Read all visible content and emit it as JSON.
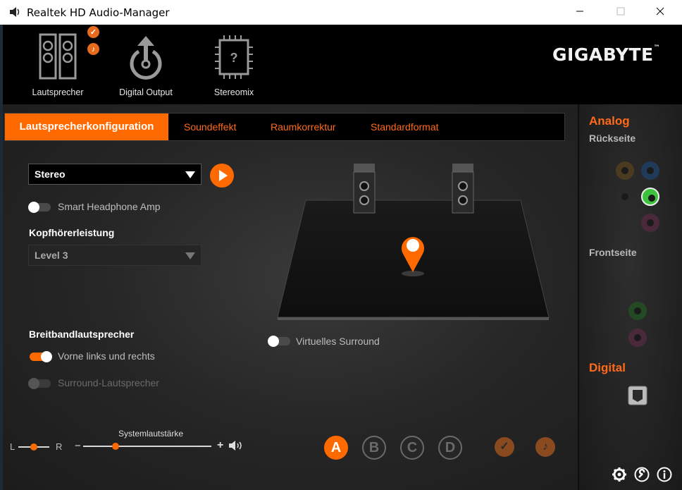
{
  "window": {
    "title": "Realtek HD Audio-Manager"
  },
  "devices": [
    {
      "label": "Lautsprecher",
      "icon": "speaker-icon",
      "active": true
    },
    {
      "label": "Digital Output",
      "icon": "digital-output-icon",
      "active": false
    },
    {
      "label": "Stereomix",
      "icon": "stereomix-chip-icon",
      "active": false
    }
  ],
  "brand": {
    "logo": "GIGABYTE",
    "trademark": "™"
  },
  "tabs": [
    {
      "label": "Lautsprecherkonfiguration",
      "active": true
    },
    {
      "label": "Soundeffekt",
      "active": false
    },
    {
      "label": "Raumkorrektur",
      "active": false
    },
    {
      "label": "Standardformat",
      "active": false
    }
  ],
  "config": {
    "speaker_mode": "Stereo",
    "smart_headphone_label": "Smart Headphone Amp",
    "smart_headphone_on": false,
    "headphone_power_heading": "Kopfhörerleistung",
    "headphone_level": "Level 3",
    "broadband_heading": "Breitbandlautsprecher",
    "front_lr_label": "Vorne links und rechts",
    "front_lr_on": true,
    "surround_label": "Surround-Lautsprecher",
    "surround_enabled": false,
    "virtual_surround_label": "Virtuelles Surround",
    "virtual_surround_on": false
  },
  "balance": {
    "left": "L",
    "right": "R",
    "value": 0.5
  },
  "volume": {
    "label": "Systemlautstärke",
    "minus": "−",
    "plus": "+",
    "value": 0.28
  },
  "profiles": [
    "A",
    "B",
    "C",
    "D"
  ],
  "active_profile": "A",
  "right_panel": {
    "analog_heading": "Analog",
    "rear_label": "Rückseite",
    "front_label": "Frontseite",
    "digital_heading": "Digital"
  },
  "colors": {
    "accent": "#ff6a00",
    "jack_green": "#3cc23c"
  }
}
